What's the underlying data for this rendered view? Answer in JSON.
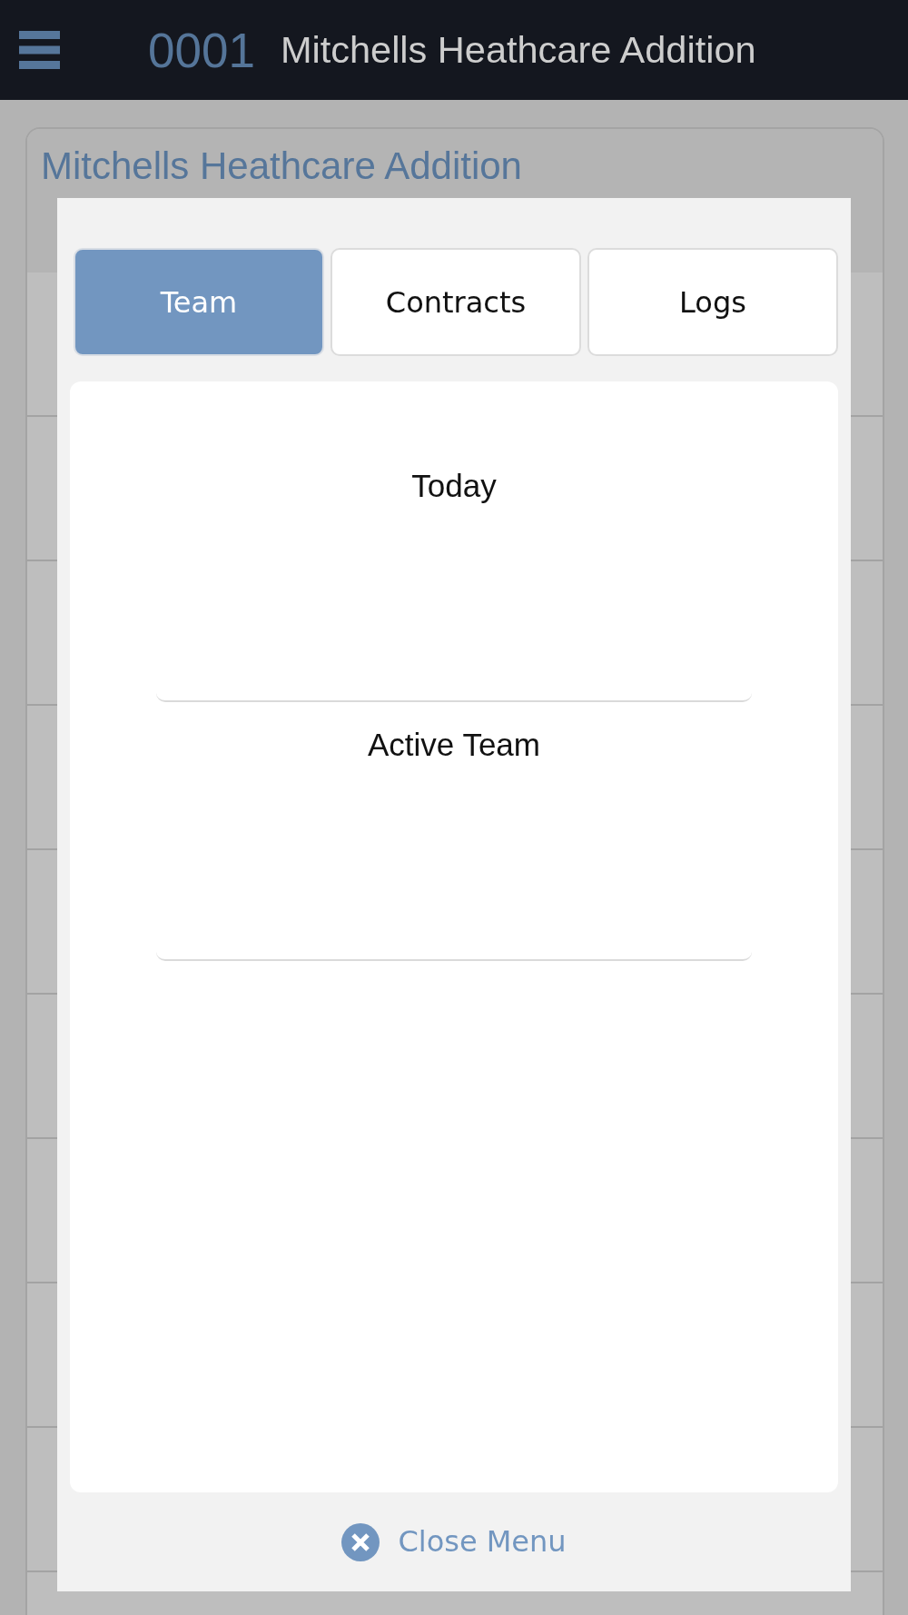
{
  "header": {
    "number": "0001",
    "title": "Mitchells Heathcare Addition"
  },
  "record": {
    "title": "Mitchells Heathcare Addition"
  },
  "menu": {
    "tabs": [
      {
        "label": "Team",
        "selected": true
      },
      {
        "label": "Contracts",
        "selected": false
      },
      {
        "label": "Logs",
        "selected": false
      }
    ],
    "sections": [
      {
        "heading": "Today"
      },
      {
        "heading": "Active Team"
      }
    ],
    "close_button": {
      "label": "Close Menu"
    }
  }
}
